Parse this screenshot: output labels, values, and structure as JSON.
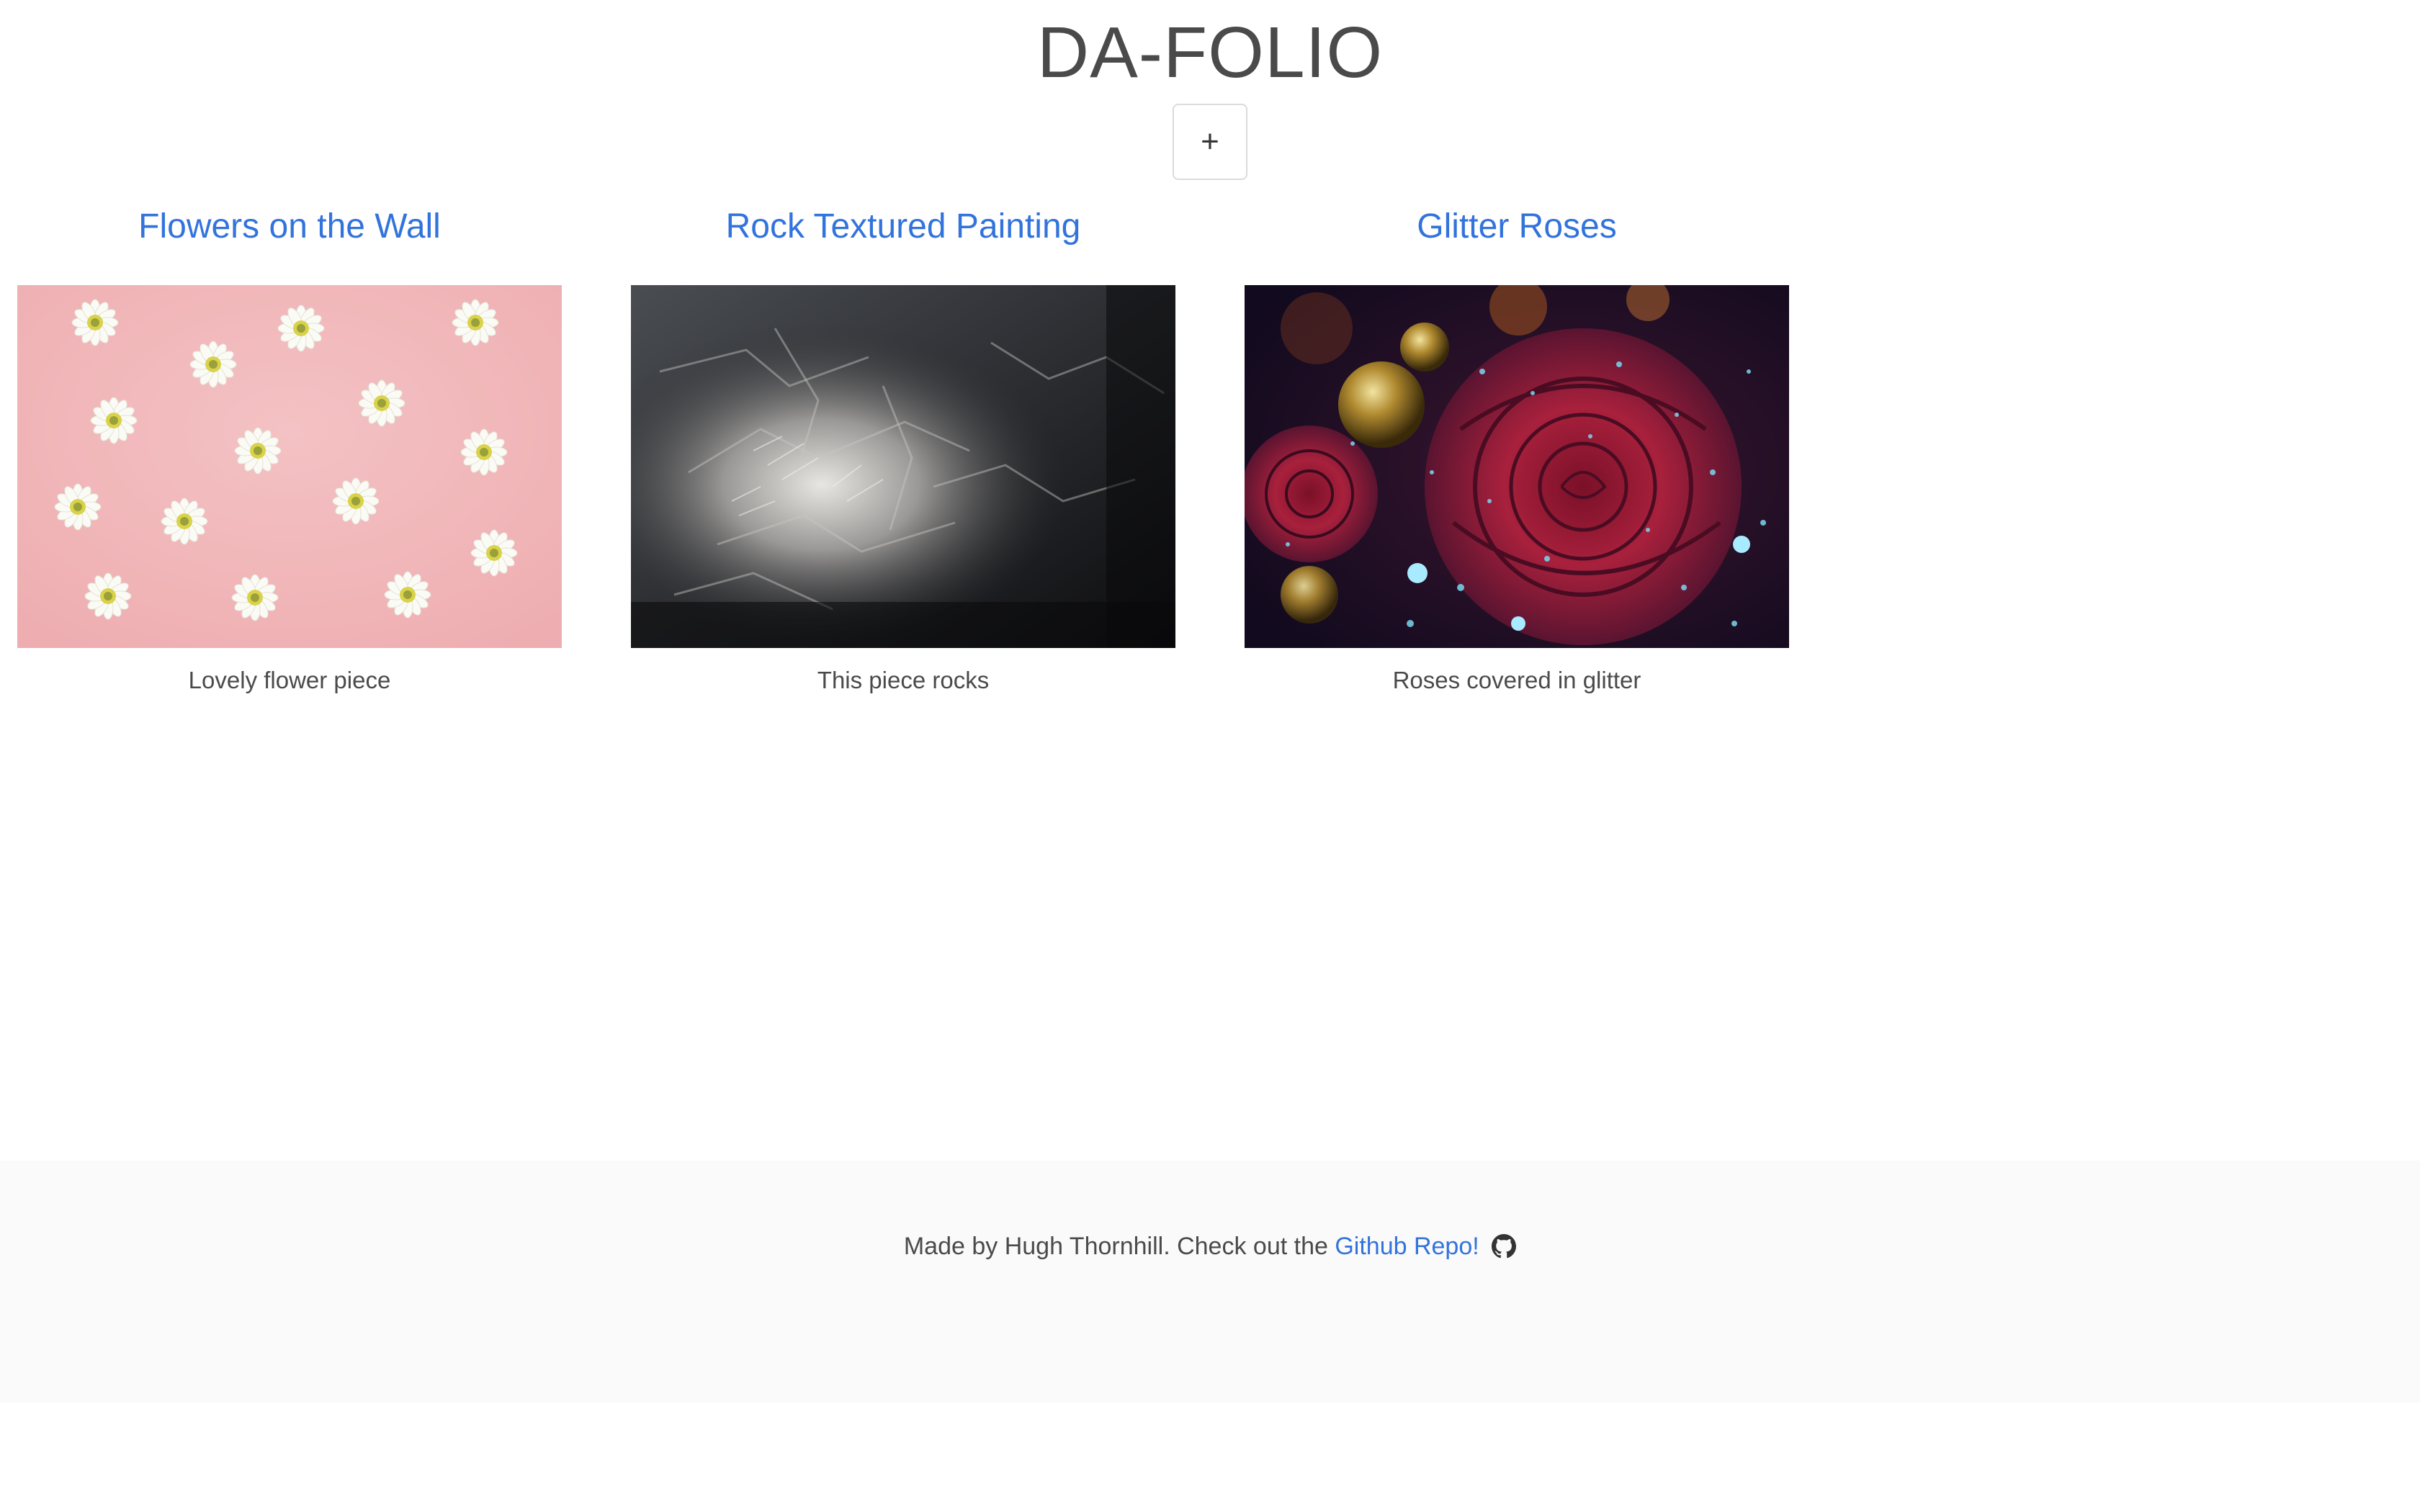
{
  "header": {
    "title": "DA-FOLIO",
    "add_button_label": "+"
  },
  "gallery": {
    "items": [
      {
        "title": "Flowers on the Wall",
        "caption": "Lovely flower piece",
        "image": "pink background with white daisies"
      },
      {
        "title": "Rock Textured Painting",
        "caption": "This piece rocks",
        "image": "black and white textured rock painting"
      },
      {
        "title": "Glitter Roses",
        "caption": "Roses covered in glitter",
        "image": "red roses with glitter and gold ornaments"
      }
    ]
  },
  "footer": {
    "text_before": "Made by Hugh Thornhill. Check out the ",
    "link_label": "Github Repo!",
    "icon": "github-icon"
  },
  "colors": {
    "link": "#3273dc",
    "text": "#4a4a4a",
    "footer_bg": "#fafafa"
  }
}
